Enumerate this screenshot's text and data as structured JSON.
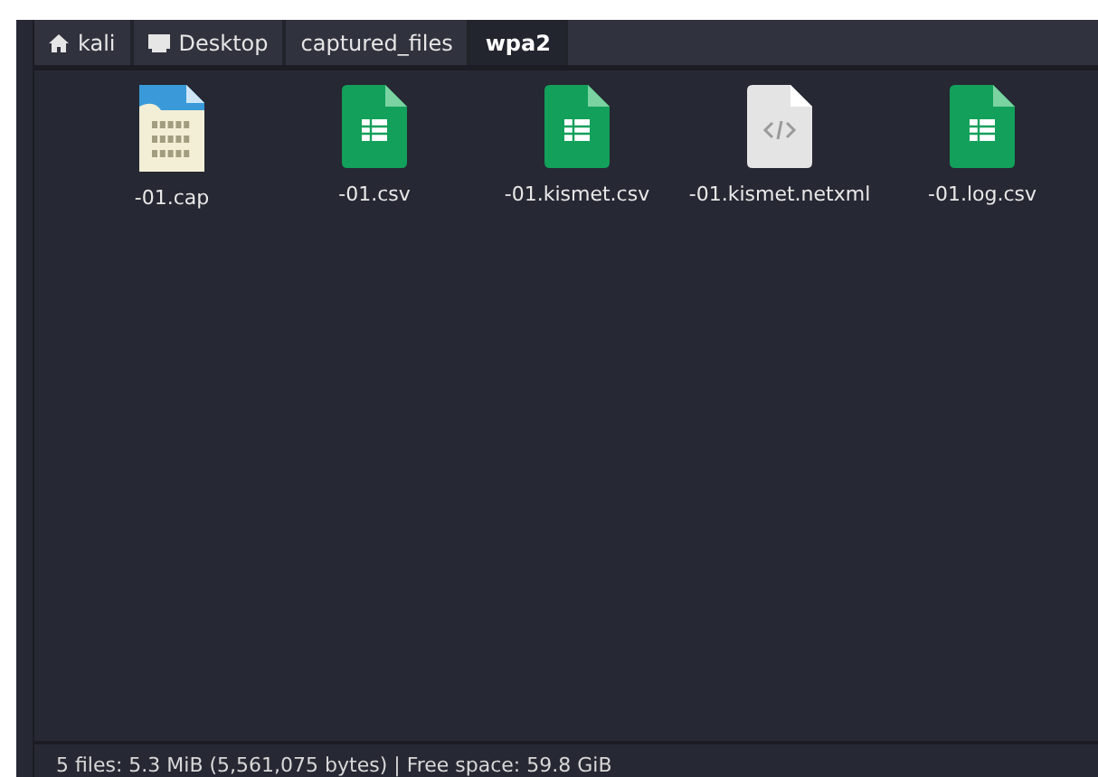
{
  "breadcrumbs": [
    {
      "label": "kali",
      "kind": "home",
      "selected": false
    },
    {
      "label": "Desktop",
      "kind": "desktop",
      "selected": false
    },
    {
      "label": "captured_files",
      "kind": "folder",
      "selected": false
    },
    {
      "label": "wpa2",
      "kind": "folder",
      "selected": true
    }
  ],
  "files": [
    {
      "name": "-01.cap",
      "kind": "binary"
    },
    {
      "name": "-01.csv",
      "kind": "spreadsheet"
    },
    {
      "name": "-01.kismet.csv",
      "kind": "spreadsheet"
    },
    {
      "name": "-01.kismet.netxml",
      "kind": "code"
    },
    {
      "name": "-01.log.csv",
      "kind": "spreadsheet"
    }
  ],
  "status_bar": "5 files: 5.3 MiB (5,561,075 bytes) | Free space: 59.8 GiB"
}
